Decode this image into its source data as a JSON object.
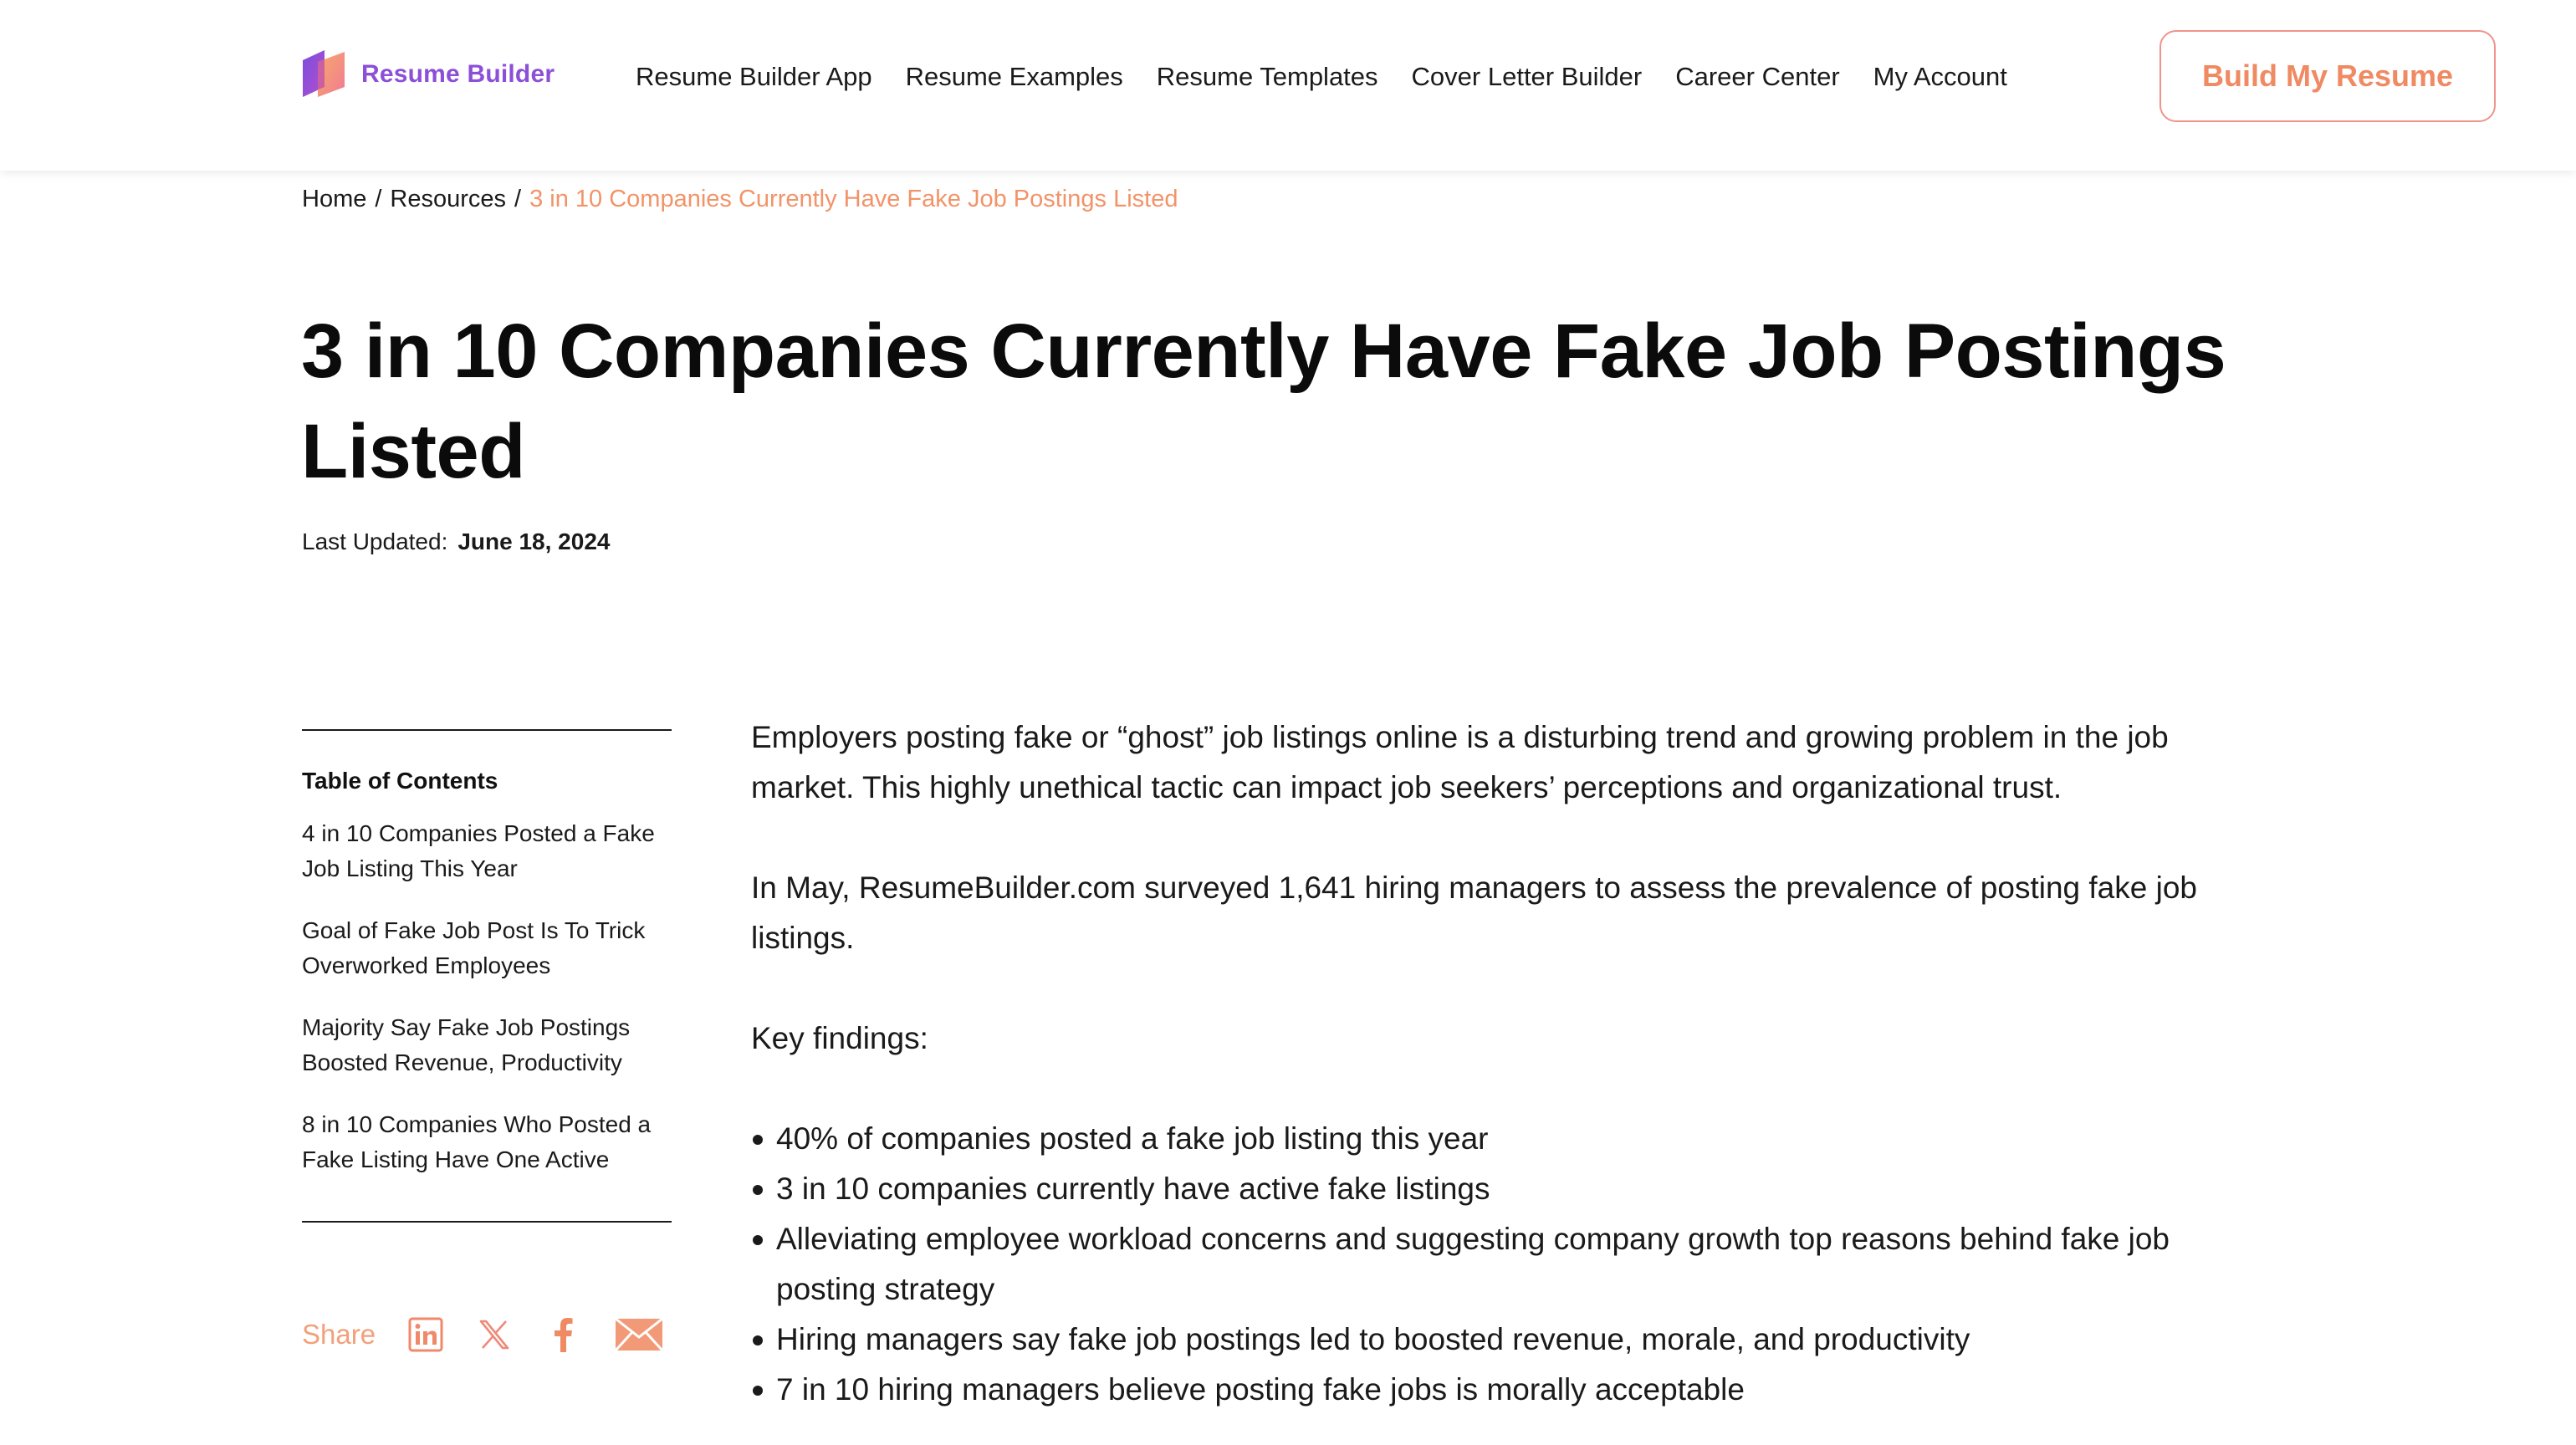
{
  "header": {
    "logo_text": "Resume Builder",
    "nav": [
      {
        "label": "Resume Builder App"
      },
      {
        "label": "Resume Examples"
      },
      {
        "label": "Resume Templates"
      },
      {
        "label": "Cover Letter Builder"
      },
      {
        "label": "Career Center"
      },
      {
        "label": "My Account"
      }
    ],
    "cta_label": "Build My Resume"
  },
  "breadcrumb": {
    "home": "Home",
    "resources": "Resources",
    "separator": "/",
    "current": "3 in 10 Companies Currently Have Fake Job Postings Listed"
  },
  "article": {
    "title": "3 in 10 Companies Currently Have Fake Job Postings Listed",
    "updated_label": "Last Updated:",
    "updated_date": "June 18, 2024",
    "paragraphs": [
      "Employers posting fake or “ghost” job listings online is a disturbing trend and growing problem in the job market. This highly unethical tactic can impact job seekers’ perceptions and organizational trust.",
      "In May, ResumeBuilder.com surveyed 1,641 hiring managers to assess the prevalence of posting fake job listings."
    ],
    "findings_heading": "Key findings:",
    "findings": [
      "40% of companies posted a fake job listing this year",
      "3 in 10 companies currently have active fake listings",
      "Alleviating employee workload concerns and suggesting company growth top reasons behind fake job posting strategy",
      "Hiring managers say fake job postings led to boosted revenue, morale, and productivity",
      "7 in 10 hiring managers believe posting fake jobs is morally acceptable"
    ]
  },
  "toc": {
    "heading": "Table of Contents",
    "items": [
      "4 in 10 Companies Posted a Fake Job Listing This Year",
      "Goal of Fake Job Post Is To Trick Overworked Employees",
      "Majority Say Fake Job Postings Boosted Revenue, Productivity",
      "8 in 10 Companies Who Posted a Fake Listing Have One Active"
    ]
  },
  "share": {
    "label": "Share",
    "icons": [
      "linkedin-icon",
      "x-icon",
      "facebook-icon",
      "email-icon"
    ]
  },
  "colors": {
    "accent_orange": "#ef8a62",
    "accent_pink": "#f0938a",
    "logo_purple": "#8c4fd8"
  }
}
